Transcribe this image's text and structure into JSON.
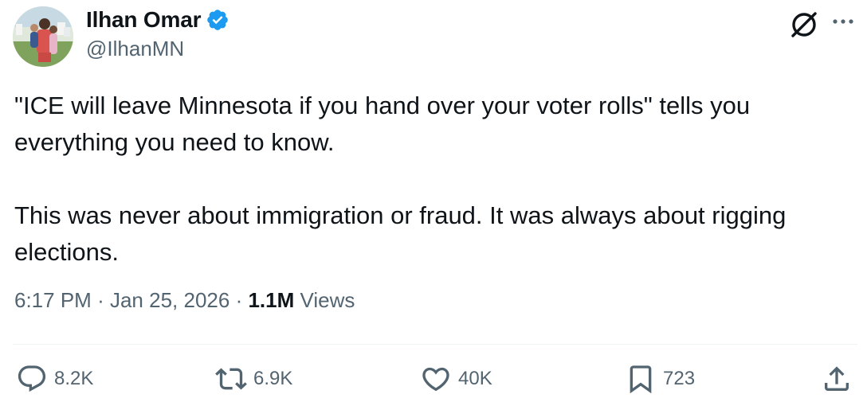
{
  "author": {
    "display_name": "Ilhan Omar",
    "handle": "@IlhanMN",
    "verified": true
  },
  "tweet": {
    "paragraphs": [
      "\"ICE will leave Minnesota if you hand over your voter rolls\" tells you everything you need to know.",
      "This was never about immigration or fraud. It was always about rigging elections."
    ],
    "time": "6:17 PM",
    "date": "Jan 25, 2026",
    "separator": "·",
    "views_count": "1.1M",
    "views_label": "Views"
  },
  "actions": {
    "replies": "8.2K",
    "reposts": "6.9K",
    "likes": "40K",
    "bookmarks": "723"
  },
  "icons": {
    "verified": "verified-badge-icon",
    "grok": "grok-icon",
    "more": "more-icon",
    "reply": "reply-icon",
    "repost": "repost-icon",
    "like": "heart-icon",
    "bookmark": "bookmark-icon",
    "share": "share-icon"
  },
  "colors": {
    "text": "#0f1419",
    "secondary": "#536471",
    "verified_blue": "#1d9bf0",
    "divider": "#eff3f4"
  }
}
